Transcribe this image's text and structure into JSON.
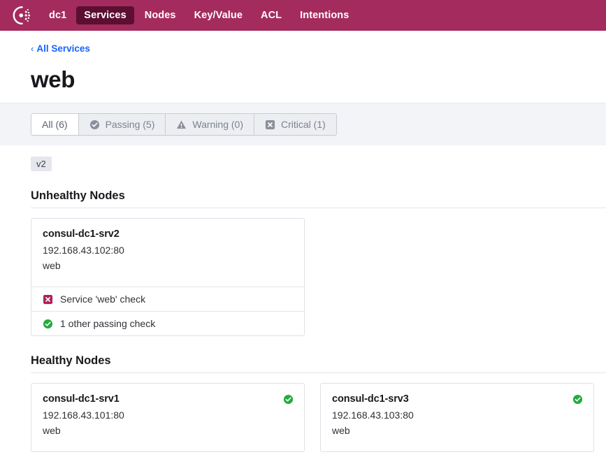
{
  "nav": {
    "logo_icon": "consul-logo-icon",
    "datacenter": "dc1",
    "items": [
      {
        "label": "Services",
        "active": true
      },
      {
        "label": "Nodes",
        "active": false
      },
      {
        "label": "Key/Value",
        "active": false
      },
      {
        "label": "ACL",
        "active": false
      },
      {
        "label": "Intentions",
        "active": false
      }
    ]
  },
  "breadcrumb": {
    "chevron": "‹",
    "label": "All Services"
  },
  "page": {
    "title": "web",
    "tag": "v2"
  },
  "filters": [
    {
      "label": "All (6)",
      "icon": "none",
      "active": true
    },
    {
      "label": "Passing (5)",
      "icon": "check-circle-icon",
      "active": false
    },
    {
      "label": "Warning (0)",
      "icon": "warning-triangle-icon",
      "active": false
    },
    {
      "label": "Critical (1)",
      "icon": "x-square-icon",
      "active": false
    }
  ],
  "sections": [
    {
      "title": "Unhealthy Nodes",
      "nodes": [
        {
          "name": "consul-dc1-srv2",
          "address": "192.168.43.102:80",
          "service": "web",
          "status": "none",
          "checks": [
            {
              "icon": "x-square-icon",
              "state": "critical",
              "label": "Service 'web' check"
            },
            {
              "icon": "check-circle-icon",
              "state": "passing",
              "label": "1 other passing check"
            }
          ]
        }
      ]
    },
    {
      "title": "Healthy Nodes",
      "nodes": [
        {
          "name": "consul-dc1-srv1",
          "address": "192.168.43.101:80",
          "service": "web",
          "status": "passing",
          "checks": []
        },
        {
          "name": "consul-dc1-srv3",
          "address": "192.168.43.103:80",
          "service": "web",
          "status": "passing",
          "checks": []
        }
      ]
    }
  ],
  "colors": {
    "brand": "#a42b5e",
    "brand_active": "#5c0f33",
    "link": "#1563ff",
    "passing": "#25ab3e",
    "critical": "#b3215a",
    "muted_icon": "#8a909c",
    "band": "#f3f4f8"
  }
}
